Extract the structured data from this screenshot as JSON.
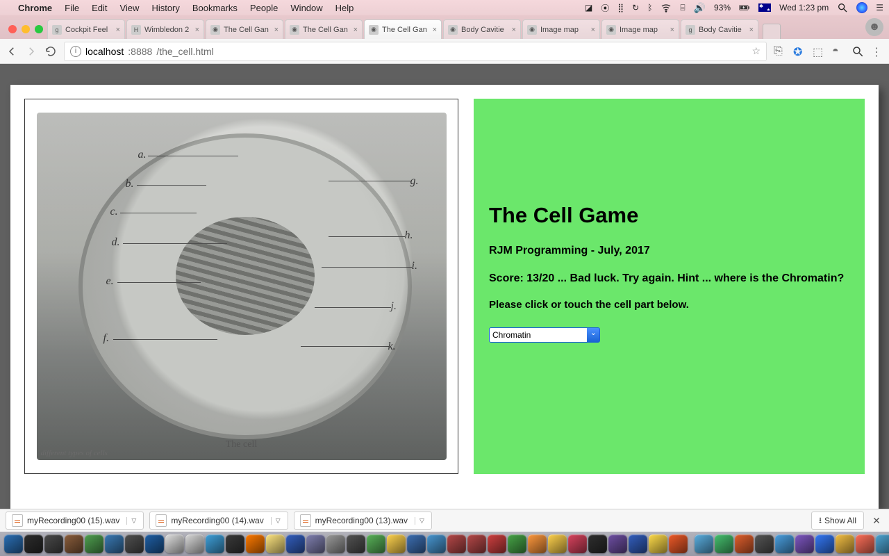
{
  "menubar": {
    "app": "Chrome",
    "items": [
      "File",
      "Edit",
      "View",
      "History",
      "Bookmarks",
      "People",
      "Window",
      "Help"
    ],
    "battery": "93%",
    "clock": "Wed 1:23 pm"
  },
  "tabs": [
    {
      "title": "Cockpit Feel",
      "fav": "g"
    },
    {
      "title": "Wimbledon 2",
      "fav": "H"
    },
    {
      "title": "The Cell Gan",
      "fav": "globe"
    },
    {
      "title": "The Cell Gan",
      "fav": "globe"
    },
    {
      "title": "The Cell Gan",
      "fav": "globe",
      "active": true
    },
    {
      "title": "Body Cavitie",
      "fav": "globe"
    },
    {
      "title": "Image map",
      "fav": "globe"
    },
    {
      "title": "Image map",
      "fav": "globe"
    },
    {
      "title": "Body Cavitie",
      "fav": "g"
    }
  ],
  "url": {
    "host": "localhost",
    "port": ":8888",
    "path": "/the_cell.html"
  },
  "diagram": {
    "labels": {
      "a": "a.",
      "b": "b.",
      "c": "c.",
      "d": "d.",
      "e": "e.",
      "f": "f.",
      "g": "g.",
      "h": "h.",
      "i": "i.",
      "j": "j.",
      "k": "k."
    },
    "caption": "The cell",
    "sidecap": "different types of cells"
  },
  "game": {
    "title": "The Cell Game",
    "subtitle": "RJM Programming - July, 2017",
    "score": "Score: 13/20 ... Bad luck. Try again. Hint ... where is the Chromatin?",
    "instruct": "Please click or touch the cell part below.",
    "selected": "Chromatin"
  },
  "downloads": {
    "items": [
      "myRecording00 (15).wav",
      "myRecording00 (14).wav",
      "myRecording00 (13).wav"
    ],
    "showall": "Show All"
  },
  "dock_colors": [
    "#2b6fb5",
    "#2d2d2d",
    "#4a4a4a",
    "#8b5e3c",
    "#50a050",
    "#3a7ab5",
    "#505050",
    "#1f5fa5",
    "#e0e0e0",
    "#d9d9d9",
    "#3fa0da",
    "#3a3a3a",
    "#ff7a00",
    "#ffe680",
    "#335fbf",
    "#8080b0",
    "#9a9a9a",
    "#535353",
    "#59b359",
    "#ffd34e",
    "#3d6fb3",
    "#4896d1",
    "#b54848",
    "#b54848",
    "#cf4040",
    "#47a447",
    "#ff983d",
    "#ffd24d",
    "#d9435e",
    "#2f2f2f",
    "#6e4fa3",
    "#335fbf",
    "#ffdc4a",
    "#ef5a28",
    "#5aaee0",
    "#46c06e",
    "#e05f2d",
    "#555555",
    "#4a9fe0",
    "#7e57c2",
    "#3478f6",
    "#f5c044",
    "#ff6f59",
    "#4da3d1"
  ]
}
